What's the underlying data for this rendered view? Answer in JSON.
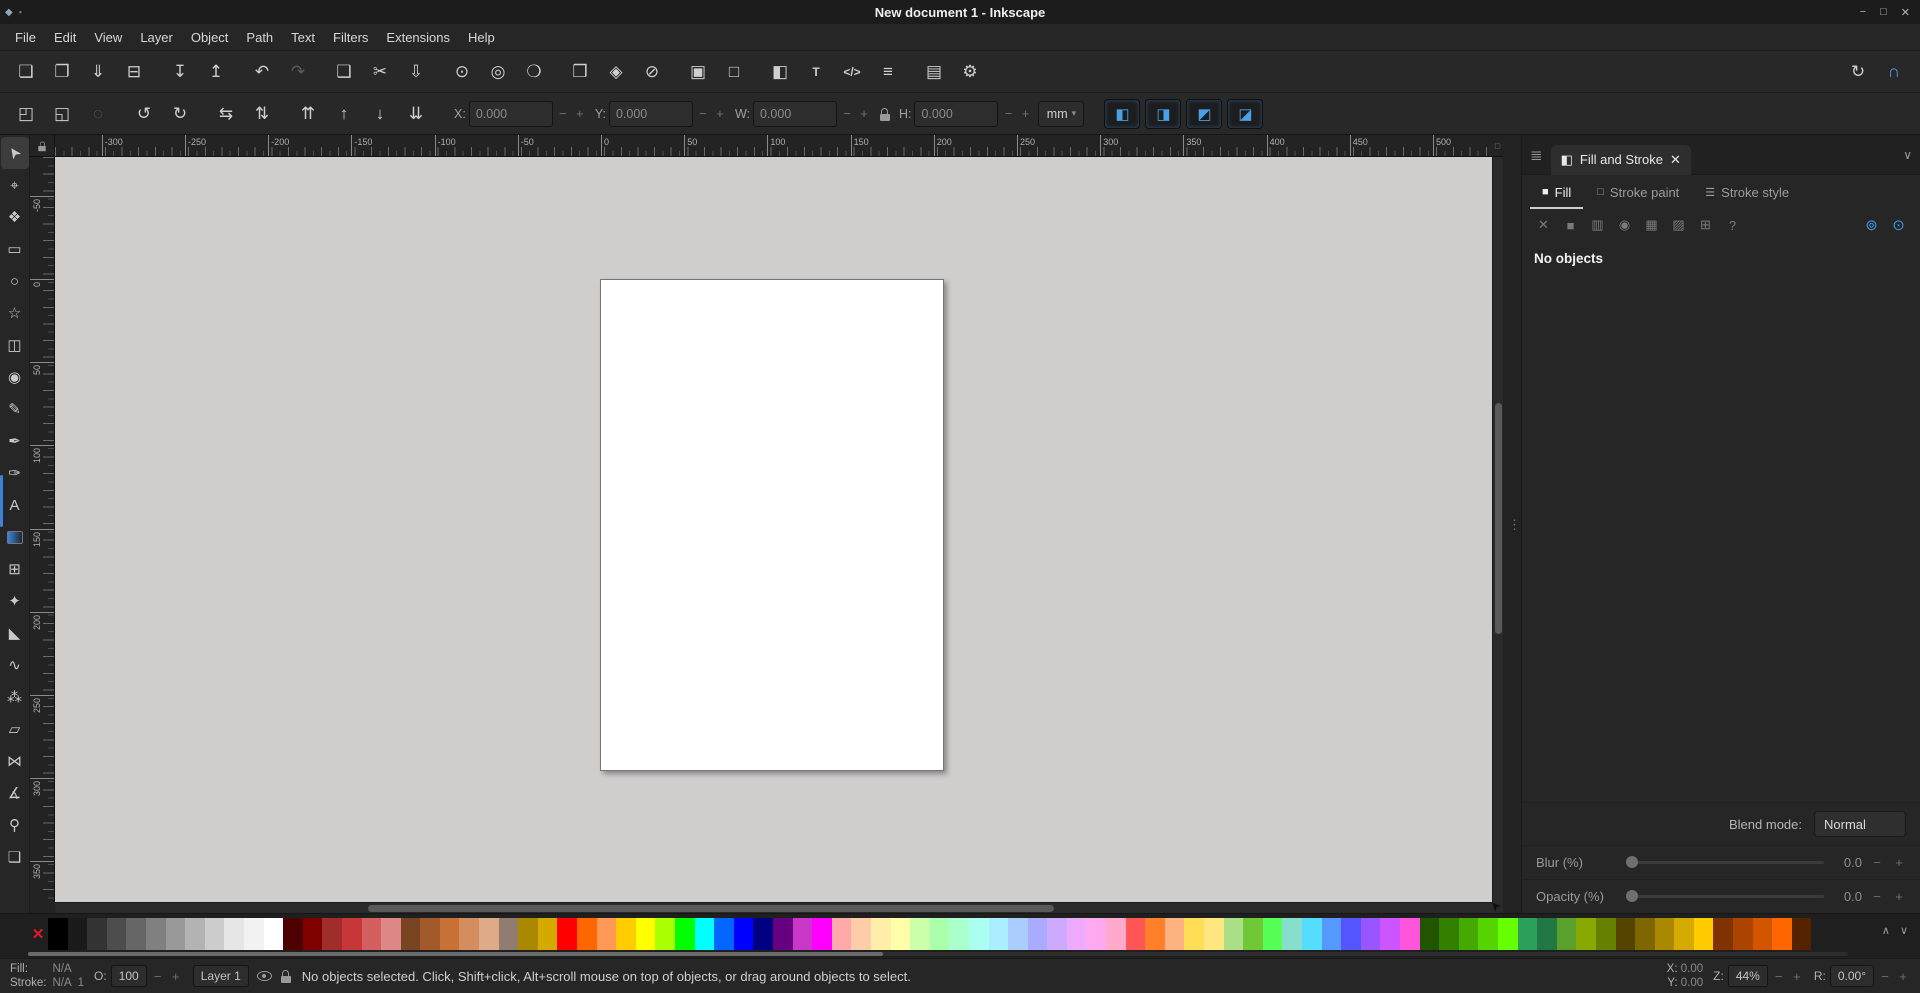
{
  "window": {
    "title": "New document 1 - Inkscape",
    "controls": {
      "minimize": "−",
      "maximize": "□",
      "close": "✕"
    }
  },
  "icons": {
    "app": "◆",
    "app_secondary": "▪",
    "minus": "−",
    "plus": "+",
    "chevron_up": "∧",
    "chevron_down": "∨",
    "dropdown_arrow": "▾",
    "panel_menu": "≣",
    "dialog_tab": "◧",
    "close_tab": "✕",
    "collapse_dock": "∨",
    "ruler_corner": "▢",
    "splitter_grip": "⋮",
    "mouse_cursor": "➤"
  },
  "menubar": {
    "items": [
      "File",
      "Edit",
      "View",
      "Layer",
      "Object",
      "Path",
      "Text",
      "Filters",
      "Extensions",
      "Help"
    ]
  },
  "command_toolbar": {
    "left": [
      {
        "name": "new-document",
        "glyph": "❏"
      },
      {
        "name": "open-document",
        "glyph": "❐"
      },
      {
        "name": "save-document",
        "glyph": "⇓"
      },
      {
        "name": "print-document",
        "glyph": "⊟"
      },
      {
        "name": "import-image",
        "glyph": "↧",
        "gap": true
      },
      {
        "name": "export-image",
        "glyph": "↥"
      },
      {
        "name": "undo",
        "glyph": "↶",
        "gap": true
      },
      {
        "name": "redo",
        "glyph": "↷",
        "disabled": true
      },
      {
        "name": "copy",
        "glyph": "❑",
        "gap": true
      },
      {
        "name": "cut",
        "glyph": "✂"
      },
      {
        "name": "paste",
        "glyph": "⇩"
      },
      {
        "name": "zoom-to-selection",
        "glyph": "⊙",
        "gap": true
      },
      {
        "name": "zoom-to-drawing",
        "glyph": "◎"
      },
      {
        "name": "zoom-to-page",
        "glyph": "❍"
      },
      {
        "name": "duplicate",
        "glyph": "❒",
        "gap": true
      },
      {
        "name": "create-clone",
        "glyph": "◈"
      },
      {
        "name": "unlink-clone",
        "glyph": "⊘"
      },
      {
        "name": "group-objects",
        "glyph": "▣",
        "gap": true
      },
      {
        "name": "ungroup-objects",
        "glyph": "□"
      },
      {
        "name": "fill-stroke-dialog",
        "glyph": "◧",
        "gap": true
      },
      {
        "name": "text-dialog",
        "glyph": "T",
        "text": true
      },
      {
        "name": "xml-editor",
        "glyph": "</>",
        "text": true
      },
      {
        "name": "align-distribute-dialog",
        "glyph": "≡"
      },
      {
        "name": "document-properties",
        "glyph": "▤",
        "gap": true
      },
      {
        "name": "preferences",
        "glyph": "⚙"
      }
    ],
    "right": [
      {
        "name": "display-rotation",
        "glyph": "↻"
      },
      {
        "name": "snapping-toggle",
        "glyph": "∩",
        "active": true
      }
    ]
  },
  "tool_controls": {
    "buttons": [
      {
        "name": "select-all",
        "glyph": "◰"
      },
      {
        "name": "select-all-layers",
        "glyph": "◱"
      },
      {
        "name": "deselect",
        "glyph": "◌",
        "disabled": true
      },
      {
        "name": "rotate-ccw",
        "glyph": "↺",
        "gap": true
      },
      {
        "name": "rotate-cw",
        "glyph": "↻"
      },
      {
        "name": "flip-horizontal",
        "glyph": "⇆",
        "gap": true
      },
      {
        "name": "flip-vertical",
        "glyph": "⇅"
      },
      {
        "name": "raise-to-top",
        "glyph": "⇈",
        "gap": true
      },
      {
        "name": "raise",
        "glyph": "↑"
      },
      {
        "name": "lower",
        "glyph": "↓"
      },
      {
        "name": "lower-to-bottom",
        "glyph": "⇊"
      }
    ],
    "fields": [
      {
        "name": "x",
        "label": "X:",
        "value": "0.000"
      },
      {
        "name": "y",
        "label": "Y:",
        "value": "0.000"
      },
      {
        "name": "w",
        "label": "W:",
        "value": "0.000"
      },
      {
        "name": "h",
        "label": "H:",
        "value": "0.000"
      }
    ],
    "unit": "mm",
    "toggles": [
      {
        "name": "scale-stroke-toggle",
        "glyph": "◧"
      },
      {
        "name": "scale-corners-toggle",
        "glyph": "◨"
      },
      {
        "name": "move-gradients-toggle",
        "glyph": "◩"
      },
      {
        "name": "move-patterns-toggle",
        "glyph": "◪"
      }
    ]
  },
  "toolbox": {
    "tools": [
      {
        "name": "selector-tool",
        "glyph": "➤",
        "active": true
      },
      {
        "name": "node-tool",
        "glyph": "⌖"
      },
      {
        "name": "shape-builder-tool",
        "glyph": "❖"
      },
      {
        "name": "rectangle-tool",
        "glyph": "▭"
      },
      {
        "name": "ellipse-tool",
        "glyph": "○"
      },
      {
        "name": "star-tool",
        "glyph": "☆"
      },
      {
        "name": "box-3d-tool",
        "glyph": "◫"
      },
      {
        "name": "spiral-tool",
        "glyph": "◉"
      },
      {
        "name": "pencil-tool",
        "glyph": "✎"
      },
      {
        "name": "pen-tool",
        "glyph": "✒"
      },
      {
        "name": "calligraphy-tool",
        "glyph": "✑"
      },
      {
        "name": "text-tool",
        "glyph": "A"
      },
      {
        "name": "gradient-tool",
        "glyph": "",
        "css": "gradient"
      },
      {
        "name": "mesh-tool",
        "glyph": "⊞"
      },
      {
        "name": "dropper-tool",
        "glyph": "✦"
      },
      {
        "name": "paint-bucket-tool",
        "glyph": "◣"
      },
      {
        "name": "tweak-tool",
        "glyph": "∿"
      },
      {
        "name": "spray-tool",
        "glyph": "⁂"
      },
      {
        "name": "eraser-tool",
        "glyph": "▱"
      },
      {
        "name": "connector-tool",
        "glyph": "⋈"
      },
      {
        "name": "measure-tool",
        "glyph": "∡"
      },
      {
        "name": "zoom-tool",
        "glyph": "⚲"
      },
      {
        "name": "pages-tool",
        "glyph": "❏"
      }
    ]
  },
  "rulers": {
    "horizontal_labels": [
      "-300",
      "-250",
      "-200",
      "-150",
      "-100",
      "-50",
      "0",
      "50",
      "100",
      "150",
      "200",
      "250",
      "300",
      "350",
      "400",
      "450",
      "500"
    ],
    "vertical_labels": [
      "-50",
      "0",
      "50",
      "100",
      "150",
      "200",
      "250",
      "300",
      "350"
    ]
  },
  "panel": {
    "tab_title": "Fill and Stroke",
    "tabs": [
      {
        "name": "tab-fill",
        "label": "Fill",
        "icon": "■",
        "active": true
      },
      {
        "name": "tab-stroke-paint",
        "label": "Stroke paint",
        "icon": "□"
      },
      {
        "name": "tab-stroke-style",
        "label": "Stroke style",
        "icon": "☰"
      }
    ],
    "paint_buttons": [
      {
        "name": "paint-none",
        "glyph": "✕"
      },
      {
        "name": "paint-flat-color",
        "glyph": "■"
      },
      {
        "name": "paint-linear-gradient",
        "glyph": "▥"
      },
      {
        "name": "paint-radial-gradient",
        "glyph": "◉"
      },
      {
        "name": "paint-pattern",
        "glyph": "▦"
      },
      {
        "name": "paint-swatch",
        "glyph": "▨"
      },
      {
        "name": "paint-mesh-gradient",
        "glyph": "⊞"
      },
      {
        "name": "paint-unknown",
        "glyph": "?"
      }
    ],
    "fill_rule_buttons": [
      {
        "name": "fill-rule-evenodd",
        "glyph": "⊚"
      },
      {
        "name": "fill-rule-nonzero",
        "glyph": "⊙"
      }
    ],
    "message": "No objects",
    "blend_label": "Blend mode:",
    "blend_value": "Normal",
    "blur_label": "Blur (%)",
    "blur_value": "0.0",
    "opacity_label": "Opacity (%)",
    "opacity_value": "0.0"
  },
  "palette": {
    "none_glyph": "✕",
    "colors": [
      "#000000",
      "#1a1a1a",
      "#333333",
      "#4d4d4d",
      "#666666",
      "#808080",
      "#999999",
      "#b3b3b3",
      "#cccccc",
      "#e6e6e6",
      "#f2f2f2",
      "#ffffff",
      "#4d0000",
      "#800000",
      "#a02c2c",
      "#c83737",
      "#d35f5f",
      "#de8787",
      "#784421",
      "#a05a2c",
      "#c87137",
      "#d38d5f",
      "#deaa87",
      "#917c6f",
      "#aa8800",
      "#d4aa00",
      "#ff0000",
      "#ff6600",
      "#ff9955",
      "#ffcc00",
      "#ffff00",
      "#aaff00",
      "#00ff00",
      "#00ffff",
      "#0066ff",
      "#0000ff",
      "#000080",
      "#660080",
      "#c837c8",
      "#ff00ff",
      "#ffaaaa",
      "#ffccaa",
      "#ffeeaa",
      "#ffffaa",
      "#ccffaa",
      "#aaffaa",
      "#aaffcc",
      "#aaffee",
      "#aaeeff",
      "#aaccff",
      "#aaaaff",
      "#ccaaff",
      "#eeaaff",
      "#ffaaee",
      "#ffaacc",
      "#ff5555",
      "#ff7f2a",
      "#ffb380",
      "#ffdd55",
      "#ffe680",
      "#aade87",
      "#71c837",
      "#55ff55",
      "#87decd",
      "#55ddff",
      "#5599ff",
      "#5555ff",
      "#9955ff",
      "#cc55ff",
      "#ff55dd",
      "#225500",
      "#338000",
      "#44aa00",
      "#55d400",
      "#66ff00",
      "#2ca05a",
      "#217844",
      "#5aa02c",
      "#88aa00",
      "#668000",
      "#554400",
      "#806600",
      "#aa8800",
      "#d4aa00",
      "#ffcc00",
      "#803300",
      "#aa4400",
      "#d45500",
      "#ff6600",
      "#552200"
    ]
  },
  "statusbar": {
    "fill_label": "Fill:",
    "fill_value": "N/A",
    "stroke_label": "Stroke:",
    "stroke_value": "N/A",
    "stroke_width": "1",
    "opacity_label": "O:",
    "opacity_value": "100",
    "layer_name": "Layer 1",
    "message": "No objects selected. Click, Shift+click, Alt+scroll mouse on top of objects, or drag around objects to select.",
    "x_label": "X:",
    "x_value": "0.00",
    "y_label": "Y:",
    "y_value": "0.00",
    "zoom_label": "Z:",
    "zoom_value": "44%",
    "rotation_label": "R:",
    "rotation_value": "0.00°"
  }
}
